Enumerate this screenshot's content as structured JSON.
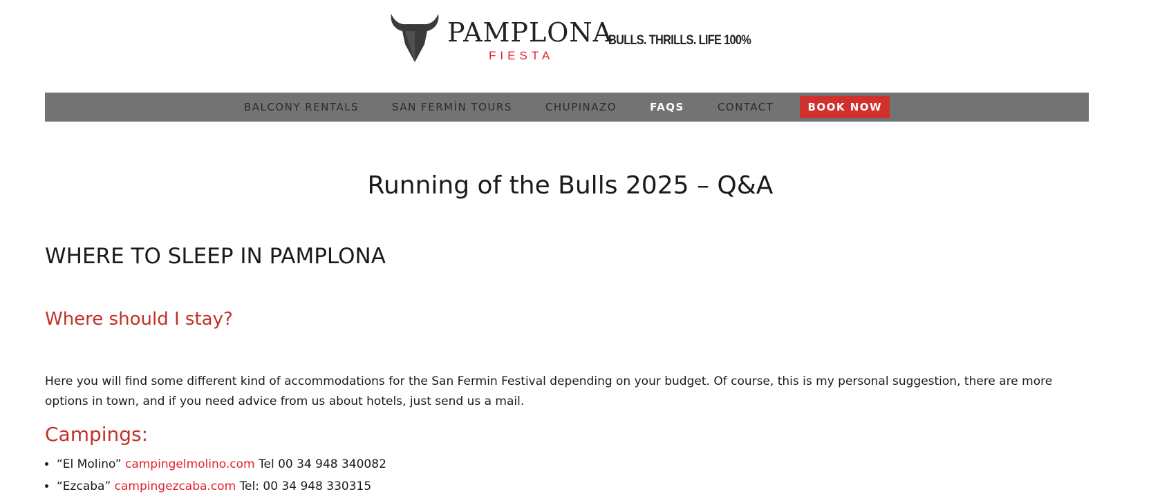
{
  "header": {
    "brand_name": "PAMPLONA",
    "brand_sub": "FIESTA",
    "tagline": "BULLS. THRILLS. LIFE 100%",
    "logo_icon": "bull-head-icon"
  },
  "nav": {
    "items": [
      {
        "label": "BALCONY RENTALS"
      },
      {
        "label": "SAN FERMÍN TOURS"
      },
      {
        "label": "CHUPINAZO"
      },
      {
        "label": "FAQS",
        "active": true
      },
      {
        "label": "CONTACT"
      }
    ],
    "cta_label": "BOOK NOW",
    "cta_color": "#d0312d",
    "bar_color": "#737373"
  },
  "main": {
    "title": "Running of the Bulls 2025 – Q&A",
    "section_heading": "WHERE TO SLEEP IN PAMPLONA",
    "question": "Where should I stay?",
    "intro": "Here you will find some different kind of accommodations for the San Fermin Festival depending on your budget. Of course, this is my personal suggestion, there are more options in town, and if you need advice from us about hotels, just send us a mail.",
    "campings_heading": "Campings:",
    "campings": [
      {
        "name": "“El Molino”",
        "link": "campingelmolino.com",
        "phone": "Tel 00 34 948 340082"
      },
      {
        "name": "“Ezcaba”",
        "link": "campingezcaba.com",
        "phone": "Tel: 00 34 948 330315"
      }
    ]
  },
  "colors": {
    "accent_red": "#c0312b",
    "link_red": "#e2202a"
  }
}
